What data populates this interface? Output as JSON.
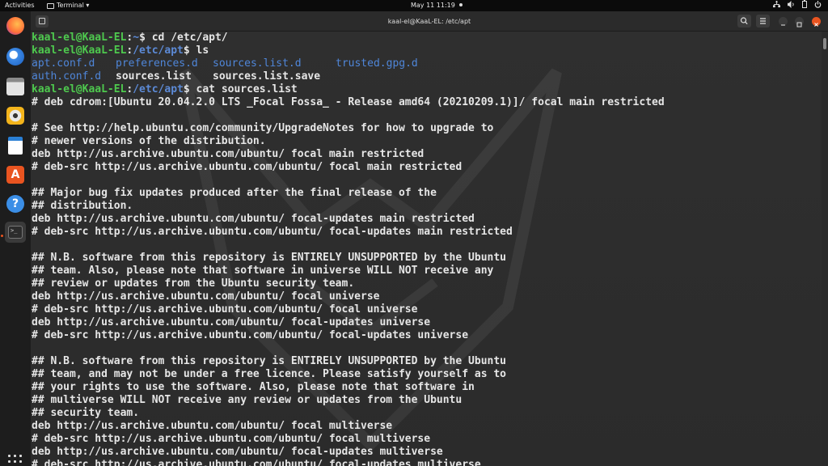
{
  "topbar": {
    "activities": "Activities",
    "app_menu": "Terminal ▾",
    "clock": "May 11  11:19"
  },
  "dock": {
    "items": [
      "firefox-icon",
      "thunderbird-icon",
      "files-icon",
      "rhythmbox-icon",
      "libreoffice-writer-icon",
      "ubuntu-software-icon",
      "help-icon",
      "terminal-icon"
    ]
  },
  "window": {
    "title": "kaal-el@KaaL-EL: /etc/apt"
  },
  "terminal": {
    "prompt_user": "kaal-el@KaaL-EL",
    "prompt_sep": ":",
    "lines": [
      {
        "type": "prompt",
        "path": "~",
        "cmd": "$ cd /etc/apt/"
      },
      {
        "type": "prompt",
        "path": "/etc/apt",
        "cmd": "$ ls"
      },
      {
        "type": "ls1",
        "a": "apt.conf.d",
        "b": "preferences.d",
        "c": "sources.list.d",
        "d": "trusted.gpg.d"
      },
      {
        "type": "ls2",
        "a": "auth.conf.d",
        "b": "sources.list",
        "c": "sources.list.save"
      },
      {
        "type": "prompt",
        "path": "/etc/apt",
        "cmd": "$ cat sources.list"
      },
      {
        "type": "text",
        "text": "# deb cdrom:[Ubuntu 20.04.2.0 LTS _Focal Fossa_ - Release amd64 (20210209.1)]/ focal main restricted"
      },
      {
        "type": "text",
        "text": ""
      },
      {
        "type": "text",
        "text": "# See http://help.ubuntu.com/community/UpgradeNotes for how to upgrade to"
      },
      {
        "type": "text",
        "text": "# newer versions of the distribution."
      },
      {
        "type": "text",
        "text": "deb http://us.archive.ubuntu.com/ubuntu/ focal main restricted"
      },
      {
        "type": "text",
        "text": "# deb-src http://us.archive.ubuntu.com/ubuntu/ focal main restricted"
      },
      {
        "type": "text",
        "text": ""
      },
      {
        "type": "text",
        "text": "## Major bug fix updates produced after the final release of the"
      },
      {
        "type": "text",
        "text": "## distribution."
      },
      {
        "type": "text",
        "text": "deb http://us.archive.ubuntu.com/ubuntu/ focal-updates main restricted"
      },
      {
        "type": "text",
        "text": "# deb-src http://us.archive.ubuntu.com/ubuntu/ focal-updates main restricted"
      },
      {
        "type": "text",
        "text": ""
      },
      {
        "type": "text",
        "text": "## N.B. software from this repository is ENTIRELY UNSUPPORTED by the Ubuntu"
      },
      {
        "type": "text",
        "text": "## team. Also, please note that software in universe WILL NOT receive any"
      },
      {
        "type": "text",
        "text": "## review or updates from the Ubuntu security team."
      },
      {
        "type": "text",
        "text": "deb http://us.archive.ubuntu.com/ubuntu/ focal universe"
      },
      {
        "type": "text",
        "text": "# deb-src http://us.archive.ubuntu.com/ubuntu/ focal universe"
      },
      {
        "type": "text",
        "text": "deb http://us.archive.ubuntu.com/ubuntu/ focal-updates universe"
      },
      {
        "type": "text",
        "text": "# deb-src http://us.archive.ubuntu.com/ubuntu/ focal-updates universe"
      },
      {
        "type": "text",
        "text": ""
      },
      {
        "type": "text",
        "text": "## N.B. software from this repository is ENTIRELY UNSUPPORTED by the Ubuntu"
      },
      {
        "type": "text",
        "text": "## team, and may not be under a free licence. Please satisfy yourself as to"
      },
      {
        "type": "text",
        "text": "## your rights to use the software. Also, please note that software in"
      },
      {
        "type": "text",
        "text": "## multiverse WILL NOT receive any review or updates from the Ubuntu"
      },
      {
        "type": "text",
        "text": "## security team."
      },
      {
        "type": "text",
        "text": "deb http://us.archive.ubuntu.com/ubuntu/ focal multiverse"
      },
      {
        "type": "text",
        "text": "# deb-src http://us.archive.ubuntu.com/ubuntu/ focal multiverse"
      },
      {
        "type": "text",
        "text": "deb http://us.archive.ubuntu.com/ubuntu/ focal-updates multiverse"
      },
      {
        "type": "text",
        "text": "# deb-src http://us.archive.ubuntu.com/ubuntu/ focal-updates multiverse"
      }
    ]
  },
  "colors": {
    "user": "#4ec94e",
    "path": "#5c8ad6",
    "accent": "#e95420"
  }
}
